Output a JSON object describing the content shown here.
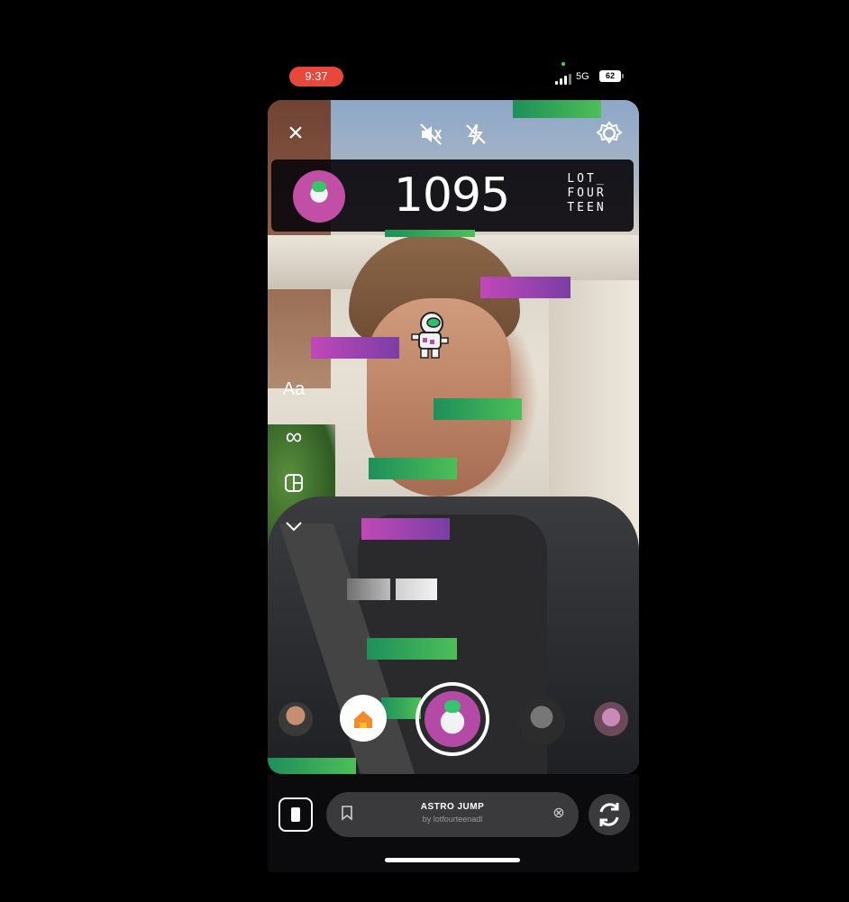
{
  "status_bar": {
    "time": "9:37",
    "network": "5G",
    "battery": "62"
  },
  "camera": {
    "top_controls": {
      "close_icon": "×",
      "mute_icon": "🔇",
      "flash_off_icon": "⚡",
      "settings_icon": "⚙"
    },
    "score_bar": {
      "score": "1095",
      "brand_lines": [
        "LOT_",
        "FOUR",
        "TEEN"
      ]
    },
    "left_toolbar": {
      "text_tool": "Aa",
      "boomerang_icon": "∞",
      "layout_icon": "⊞",
      "more_icon": "⌄"
    }
  },
  "effect_bar": {
    "title": "ASTRO JUMP",
    "author": "by lotfourteenadl",
    "close_icon": "⊗",
    "bookmark_icon": "⌑",
    "flip_icon": "⟳"
  },
  "colors": {
    "time_pill": "#e8483a",
    "platform_green": "#3aa85a",
    "platform_purple": "#a545b0"
  }
}
